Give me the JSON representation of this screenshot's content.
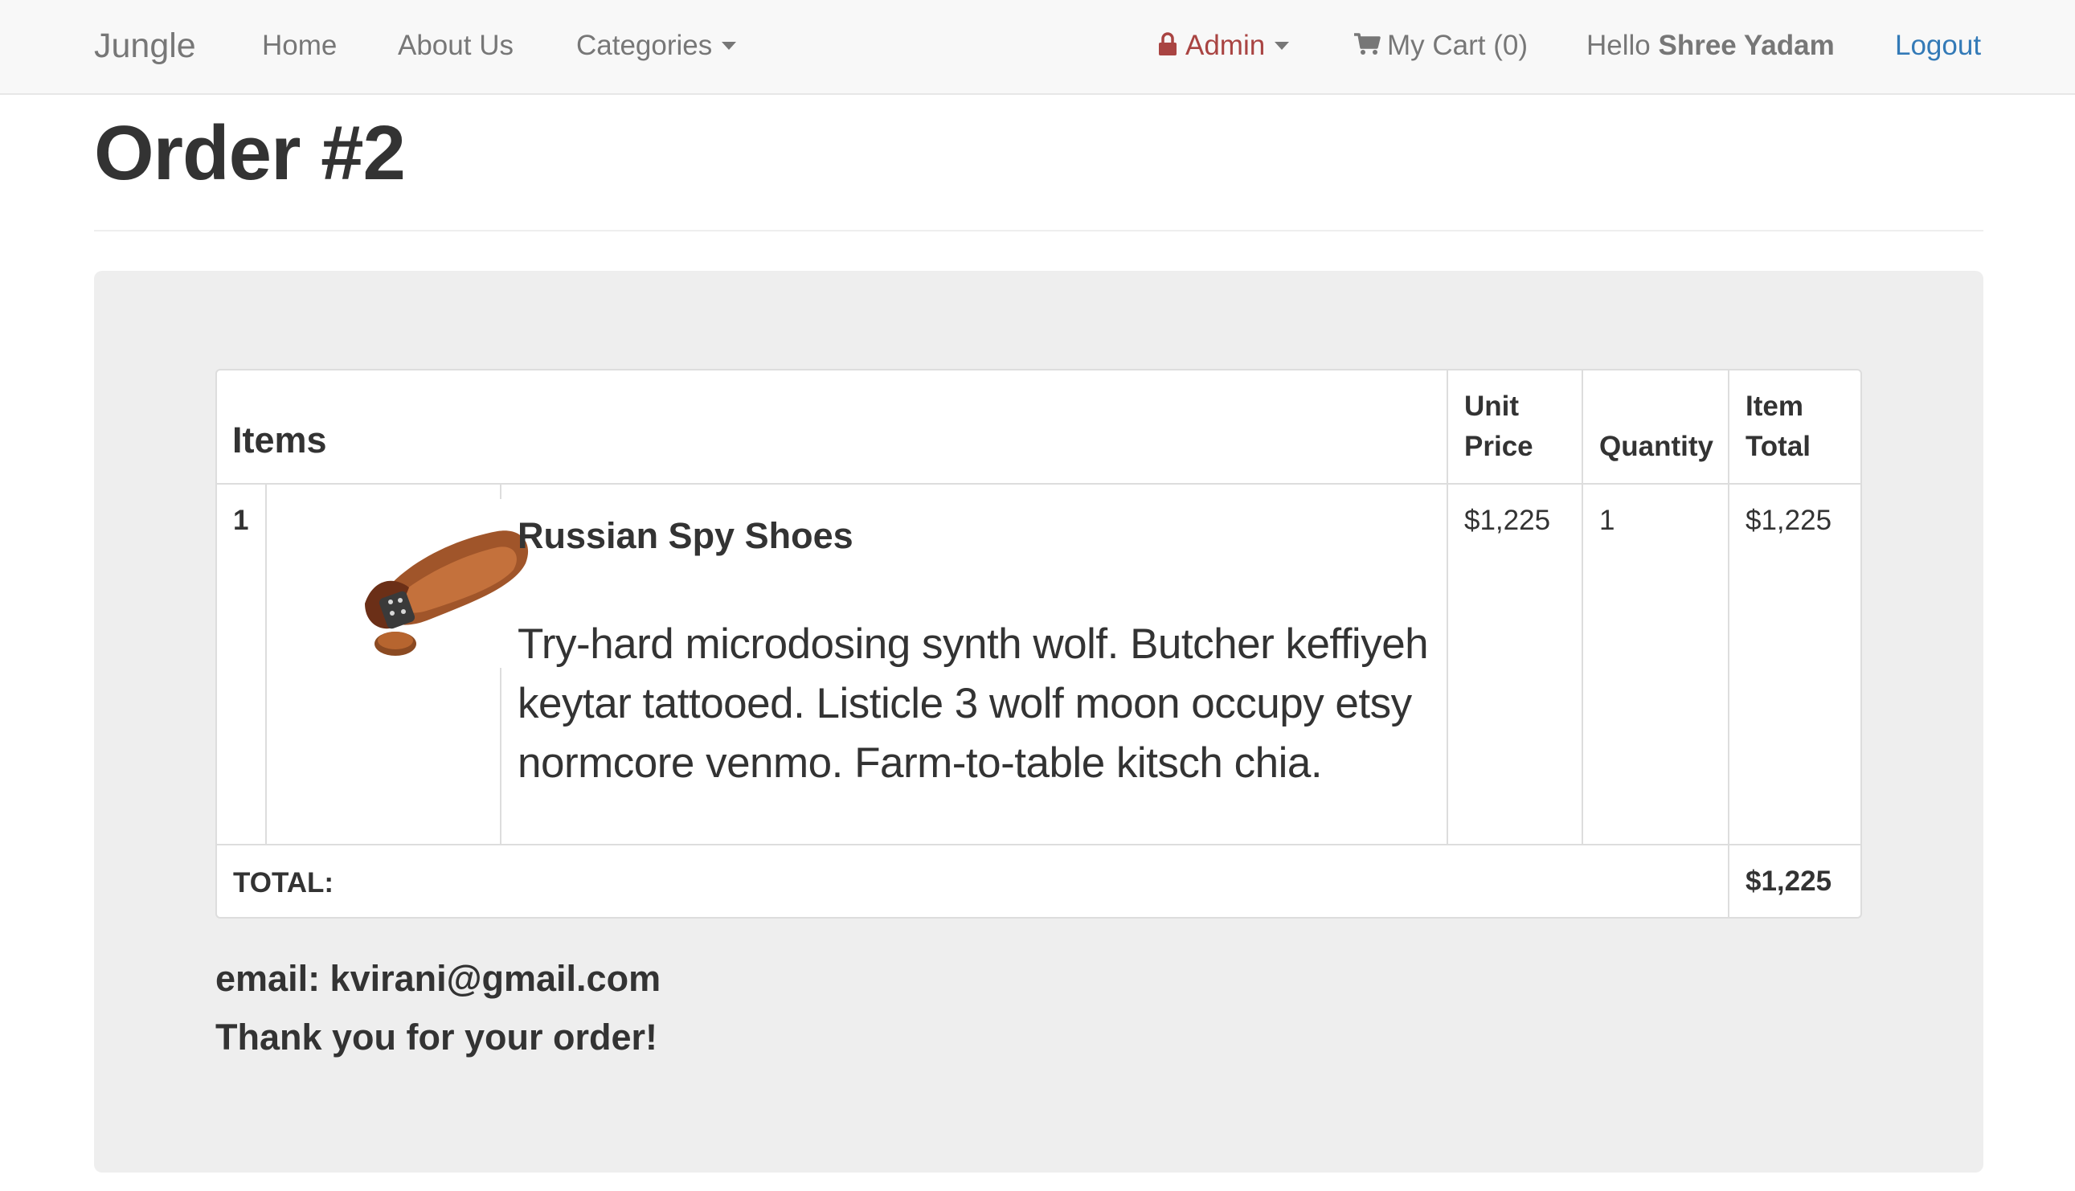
{
  "navbar": {
    "brand": "Jungle",
    "links": {
      "home": "Home",
      "about": "About Us",
      "categories": "Categories"
    },
    "admin_label": "Admin",
    "cart_label": "My Cart (0)",
    "hello_prefix": "Hello",
    "user_name": "Shree Yadam",
    "logout_label": "Logout"
  },
  "page": {
    "title": "Order #2"
  },
  "table": {
    "headers": {
      "items": "Items",
      "unit_price_line1": "Unit",
      "unit_price_line2": "Price",
      "quantity": "Quantity",
      "item_total_line1": "Item",
      "item_total_line2": "Total"
    },
    "rows": [
      {
        "index": "1",
        "image_icon": "brown-shoe-image",
        "name": "Russian Spy Shoes",
        "description_lines": [
          "Try-hard microdosing synth wolf. Butcher keffiyeh",
          "keytar tattooed. Listicle 3 wolf moon occupy etsy",
          "normcore venmo. Farm-to-table kitsch chia."
        ],
        "unit_price": "$1,225",
        "quantity": "1",
        "item_total": "$1,225"
      }
    ],
    "total_label": "TOTAL:",
    "total_value": "$1,225"
  },
  "footer": {
    "email_line": "email: kvirani@gmail.com",
    "thanks": "Thank you for your order!"
  },
  "colors": {
    "navbar_bg": "#f8f8f8",
    "admin_red": "#a94442",
    "link_blue": "#337ab7",
    "panel_bg": "#eeeeee"
  }
}
